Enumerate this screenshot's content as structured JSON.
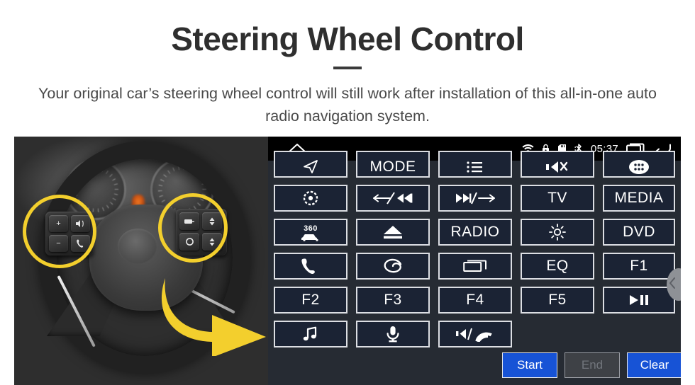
{
  "header": {
    "title": "Steering Wheel Control",
    "subtitle": "Your original car’s steering wheel control will still work after installation of this all-in-one auto radio navigation system."
  },
  "photo": {
    "alt_name": "steering-wheel-photo",
    "highlight_color": "#f3cf2d",
    "left_pad_keys": [
      "+",
      "−",
      "voice-icon",
      "phone-icon"
    ],
    "right_pad_keys": [
      "display-icon",
      "up-arrow-icon",
      "circle-icon",
      "down-arrow-icon"
    ]
  },
  "head_unit": {
    "background_color": "#262b33",
    "button_fill": "#1b2334",
    "button_border": "#dcdee3",
    "statusbar": {
      "background_color": "#000000",
      "home_icon": "home-icon",
      "time": "05:37",
      "icons": [
        "wifi-icon",
        "lock-icon",
        "sd-card-icon",
        "bluetooth-icon"
      ],
      "recents_icon": "recents-icon",
      "back_icon": "back-icon"
    },
    "scroll_handle": {
      "icon": "chevron-left-icon",
      "color": "#8e9196"
    },
    "rows": [
      [
        {
          "name": "navigation",
          "type": "icon",
          "icon": "navigation-arrow-icon",
          "label": ""
        },
        {
          "name": "mode",
          "type": "text",
          "icon": "",
          "label": "MODE"
        },
        {
          "name": "menu-list",
          "type": "icon",
          "icon": "list-icon",
          "label": ""
        },
        {
          "name": "mute",
          "type": "icon",
          "icon": "speaker-mute-icon",
          "label": ""
        },
        {
          "name": "app-drawer",
          "type": "icon",
          "icon": "app-drawer-icon",
          "label": ""
        }
      ],
      [
        {
          "name": "settings",
          "type": "icon",
          "icon": "gear-icon",
          "label": ""
        },
        {
          "name": "previous-track",
          "type": "icon",
          "icon": "prev-track-icon",
          "label": ""
        },
        {
          "name": "next-track",
          "type": "icon",
          "icon": "next-track-icon",
          "label": ""
        },
        {
          "name": "tv",
          "type": "text",
          "icon": "",
          "label": "TV"
        },
        {
          "name": "media",
          "type": "text",
          "icon": "",
          "label": "MEDIA"
        }
      ],
      [
        {
          "name": "camera-360",
          "type": "icon",
          "icon": "camera-360-icon",
          "label": "360"
        },
        {
          "name": "eject",
          "type": "icon",
          "icon": "eject-icon",
          "label": ""
        },
        {
          "name": "radio",
          "type": "text",
          "icon": "",
          "label": "RADIO"
        },
        {
          "name": "brightness",
          "type": "icon",
          "icon": "brightness-icon",
          "label": ""
        },
        {
          "name": "dvd",
          "type": "text",
          "icon": "",
          "label": "DVD"
        }
      ],
      [
        {
          "name": "phone-call",
          "type": "icon",
          "icon": "phone-icon",
          "label": ""
        },
        {
          "name": "swirl-app",
          "type": "icon",
          "icon": "swirl-icon",
          "label": ""
        },
        {
          "name": "recent-apps",
          "type": "icon",
          "icon": "window-icon",
          "label": ""
        },
        {
          "name": "equalizer",
          "type": "text",
          "icon": "",
          "label": "EQ"
        },
        {
          "name": "function-1",
          "type": "text",
          "icon": "",
          "label": "F1"
        }
      ],
      [
        {
          "name": "function-2",
          "type": "text",
          "icon": "",
          "label": "F2"
        },
        {
          "name": "function-3",
          "type": "text",
          "icon": "",
          "label": "F3"
        },
        {
          "name": "function-4",
          "type": "text",
          "icon": "",
          "label": "F4"
        },
        {
          "name": "function-5",
          "type": "text",
          "icon": "",
          "label": "F5"
        },
        {
          "name": "play-pause",
          "type": "icon",
          "icon": "play-pause-icon",
          "label": ""
        }
      ],
      [
        {
          "name": "music",
          "type": "icon",
          "icon": "music-note-icon",
          "label": ""
        },
        {
          "name": "voice-mic",
          "type": "icon",
          "icon": "microphone-icon",
          "label": ""
        },
        {
          "name": "volume-hangup",
          "type": "icon",
          "icon": "speaker-hangup-icon",
          "label": ""
        }
      ]
    ],
    "actions": [
      {
        "name": "start",
        "label": "Start",
        "state": "enabled",
        "color": "#1753d6"
      },
      {
        "name": "end",
        "label": "End",
        "state": "disabled",
        "color": "#3e4146"
      },
      {
        "name": "clear",
        "label": "Clear",
        "state": "enabled",
        "color": "#1753d6"
      }
    ]
  }
}
